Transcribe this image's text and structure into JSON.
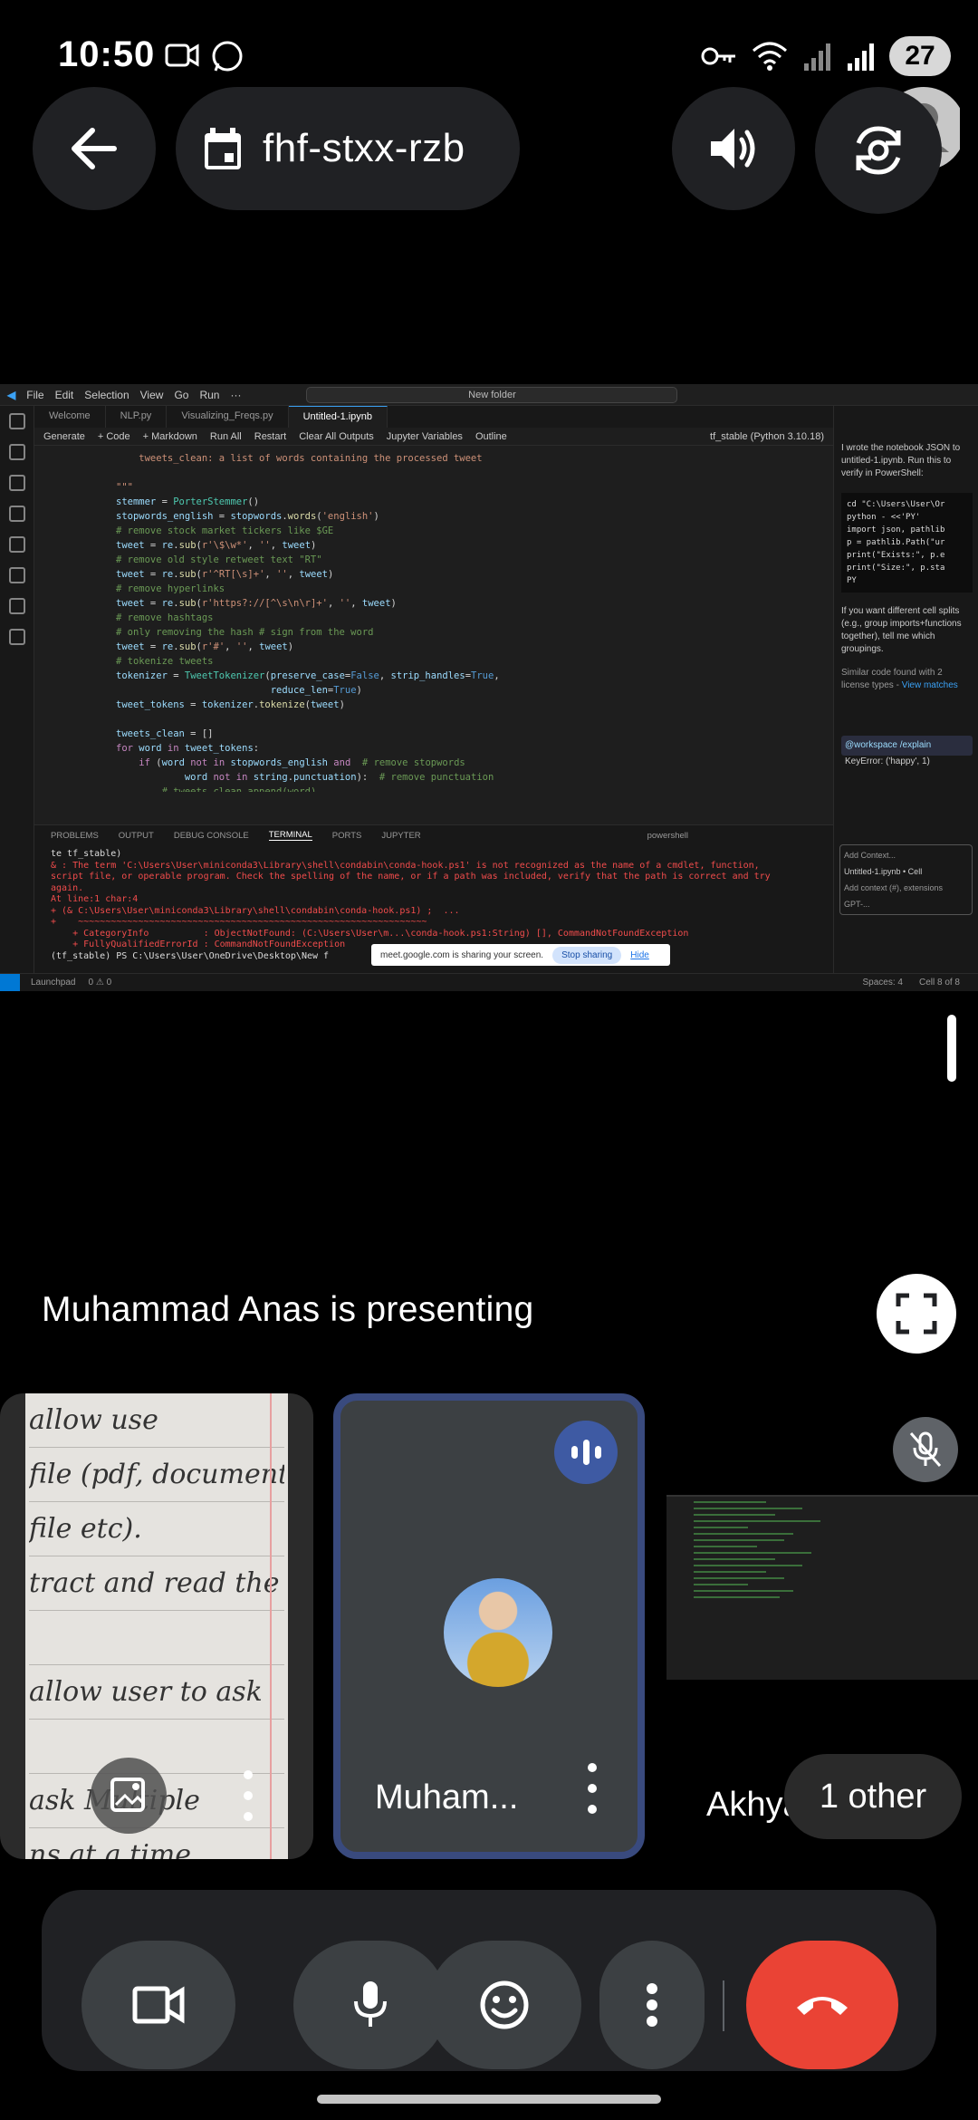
{
  "status_bar": {
    "time": "10:50",
    "battery": "27"
  },
  "meeting": {
    "code": "fhf-stxx-rzb",
    "presenting_label": "Muhammad Anas is presenting"
  },
  "vscode": {
    "menu": [
      "File",
      "Edit",
      "Selection",
      "View",
      "Go",
      "Run",
      "···"
    ],
    "search_placeholder": "New folder",
    "tabs": [
      "Welcome",
      "NLP.py",
      "Visualizing_Freqs.py",
      "Untitled-1.ipynb"
    ],
    "toolbar": [
      "Generate",
      "+ Code",
      "+ Markdown",
      "Run All",
      "Restart",
      "Clear All Outputs",
      "Jupyter Variables",
      "Outline"
    ],
    "kernel": "tf_stable (Python 3.10.18)",
    "terminal_tabs": [
      "PROBLEMS",
      "OUTPUT",
      "DEBUG CONSOLE",
      "TERMINAL",
      "PORTS",
      "JUPYTER"
    ],
    "terminal_shell": "powershell",
    "share_text": "meet.google.com is sharing your screen.",
    "share_stop": "Stop sharing",
    "share_hide": "Hide",
    "status_left": "Launchpad",
    "status_counts": "0 ⚠ 0",
    "status_spaces": "Spaces: 4",
    "status_cell": "Cell 8 of 8",
    "chat_text_1": "I wrote the notebook JSON to untitled-1.ipynb. Run this to verify in PowerShell:",
    "chat_text_2": "If you want different cell splits (e.g., group imports+functions together), tell me which groupings.",
    "chat_text_3": "Similar code found with 2 license types -",
    "chat_link": "View matches",
    "chat_ref": "@workspace /explain",
    "chat_ref_2": "KeyError: ('happy', 1)",
    "chat_add_context": "Add Context...",
    "chat_file": "Untitled-1.ipynb • Cell",
    "chat_input_placeholder": "Add context (#), extensions",
    "chat_model": "GPT-..."
  },
  "tiles": [
    {
      "name": "",
      "type": "notebook"
    },
    {
      "name": "Muham...",
      "type": "avatar",
      "speaking": true
    },
    {
      "name": "Akhya",
      "type": "screen",
      "muted": true
    }
  ],
  "other_pill": "1 other",
  "icons": [
    "back-arrow-icon",
    "calendar-icon",
    "speaker-icon",
    "camera-switch-icon",
    "fullscreen-icon",
    "camera-icon",
    "mic-icon",
    "emoji-icon",
    "more-icon",
    "end-call-icon"
  ]
}
